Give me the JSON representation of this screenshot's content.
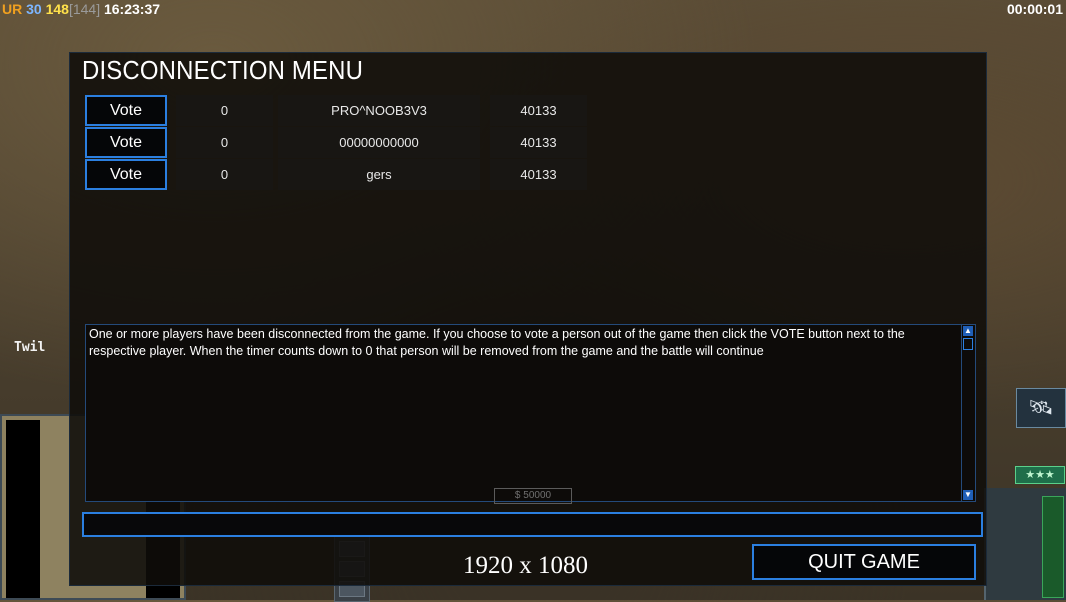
{
  "hud": {
    "faction": "UR",
    "power": "30",
    "credits": "148",
    "credits_max": "[144]",
    "clock": "16:23:37",
    "elapsed": "00:00:01",
    "colors": {
      "faction": "#f0a020",
      "power": "#7db6ff",
      "credits": "#ffe14a"
    }
  },
  "world": {
    "player_label": "Twil",
    "money": "$ 50000",
    "rank_stars": "★★★"
  },
  "dialog": {
    "title": "DISCONNECTION MENU",
    "players": [
      {
        "vote_label": "Vote",
        "timer": "0",
        "name": "PRO^NOOB3V3",
        "ping": "40133"
      },
      {
        "vote_label": "Vote",
        "timer": "0",
        "name": "00000000000",
        "ping": "40133"
      },
      {
        "vote_label": "Vote",
        "timer": "0",
        "name": "gers",
        "ping": "40133"
      }
    ],
    "message": "One or more players have been disconnected from the game. If you choose to vote a person out of the game then click the VOTE button next to the respective player. When the timer counts down to 0 that person will be removed from the game and the battle will continue",
    "chat_value": "",
    "quit_label": "QUIT GAME"
  },
  "overlay": {
    "resolution": "1920 x 1080"
  }
}
